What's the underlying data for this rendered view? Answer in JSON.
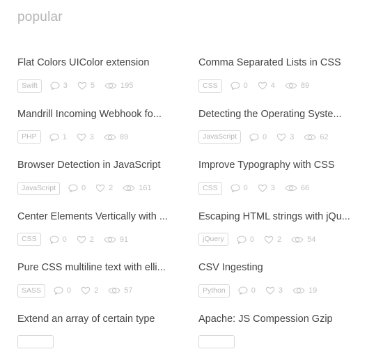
{
  "section": {
    "title": "popular"
  },
  "items": [
    {
      "title": "Flat Colors UIColor extension",
      "tag": "Swift",
      "comments": "3",
      "likes": "5",
      "views": "195"
    },
    {
      "title": "Comma Separated Lists in CSS",
      "tag": "CSS",
      "comments": "0",
      "likes": "4",
      "views": "89"
    },
    {
      "title": "Mandrill Incoming Webhook fo...",
      "tag": "PHP",
      "comments": "1",
      "likes": "3",
      "views": "89"
    },
    {
      "title": "Detecting the Operating Syste...",
      "tag": "JavaScript",
      "comments": "0",
      "likes": "3",
      "views": "62"
    },
    {
      "title": "Browser Detection in JavaScript",
      "tag": "JavaScript",
      "comments": "0",
      "likes": "2",
      "views": "161"
    },
    {
      "title": "Improve Typography with CSS",
      "tag": "CSS",
      "comments": "0",
      "likes": "3",
      "views": "66"
    },
    {
      "title": "Center Elements Vertically with ...",
      "tag": "CSS",
      "comments": "0",
      "likes": "2",
      "views": "91"
    },
    {
      "title": "Escaping HTML strings with jQu...",
      "tag": "jQuery",
      "comments": "0",
      "likes": "2",
      "views": "54"
    },
    {
      "title": "Pure CSS multiline text with elli...",
      "tag": "SASS",
      "comments": "0",
      "likes": "2",
      "views": "57"
    },
    {
      "title": "CSV Ingesting",
      "tag": "Python",
      "comments": "0",
      "likes": "3",
      "views": "19"
    },
    {
      "title": "Extend an array of certain type",
      "tag": "",
      "comments": "",
      "likes": "",
      "views": ""
    },
    {
      "title": "Apache: JS Compession Gzip",
      "tag": "",
      "comments": "",
      "likes": "",
      "views": ""
    }
  ],
  "icons": {
    "comments": "comment-icon",
    "likes": "heart-icon",
    "views": "eye-icon"
  },
  "colors": {
    "title": "#b4b4b4",
    "text": "#444444",
    "meta": "#c2c2c2",
    "tag_border": "#d8d8d8"
  }
}
